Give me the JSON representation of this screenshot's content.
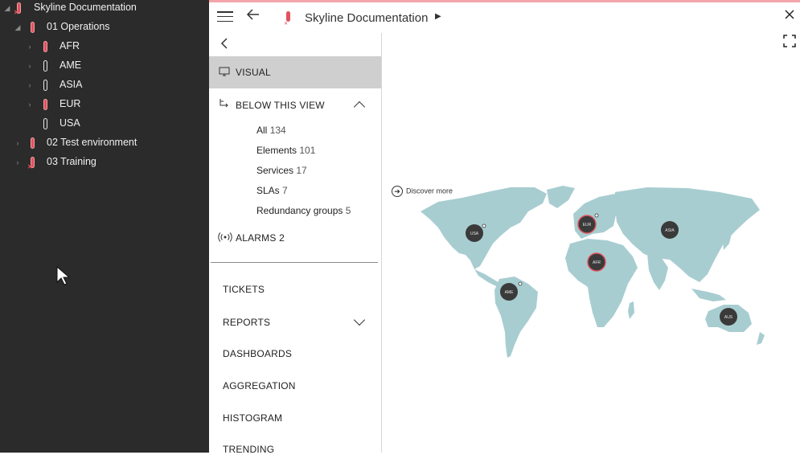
{
  "tree": {
    "root": {
      "label": "Skyline Documentation"
    },
    "items": [
      {
        "label": "01 Operations",
        "level": 1,
        "state": "red",
        "expanded": true
      },
      {
        "label": "AFR",
        "level": 2,
        "state": "red",
        "expanded": false
      },
      {
        "label": "AME",
        "level": 2,
        "state": "white",
        "expanded": false
      },
      {
        "label": "ASIA",
        "level": 2,
        "state": "white",
        "expanded": false
      },
      {
        "label": "EUR",
        "level": 2,
        "state": "red",
        "expanded": false
      },
      {
        "label": "USA",
        "level": 2,
        "state": "white",
        "expanded": null
      },
      {
        "label": "02 Test environment",
        "level": 1,
        "state": "red",
        "expanded": false
      },
      {
        "label": "03 Training",
        "level": 1,
        "state": "red-x",
        "expanded": false
      }
    ]
  },
  "header": {
    "title": "Skyline Documentation"
  },
  "nav": {
    "visual": "VISUAL",
    "below": {
      "label": "BELOW THIS VIEW",
      "items": [
        {
          "label": "All",
          "count": "134"
        },
        {
          "label": "Elements",
          "count": "101"
        },
        {
          "label": "Services",
          "count": "17"
        },
        {
          "label": "SLAs",
          "count": "7"
        },
        {
          "label": "Redundancy groups",
          "count": "5"
        }
      ]
    },
    "alarms": {
      "label": "ALARMS",
      "count": "2"
    },
    "sections": {
      "tickets": "TICKETS",
      "reports": "REPORTS",
      "dashboards": "DASHBOARDS",
      "aggregation": "AGGREGATION",
      "histogram": "HISTOGRAM",
      "trending": "TRENDING"
    }
  },
  "map": {
    "discover": "Discover more",
    "land_color": "#a8cdd1",
    "marker_color": "#3a3a3a",
    "alarm_ring_color": "#e0525d",
    "regions": [
      {
        "label": "USA",
        "alarm": false
      },
      {
        "label": "EUR",
        "alarm": true
      },
      {
        "label": "ASIA",
        "alarm": false
      },
      {
        "label": "AFR",
        "alarm": true
      },
      {
        "label": "AME",
        "alarm": false
      },
      {
        "label": "AUS",
        "alarm": false
      }
    ]
  },
  "colors": {
    "accent": "#e0525d",
    "tree_bg": "#2b2b2b",
    "selected_bg": "#cfcfcf"
  }
}
